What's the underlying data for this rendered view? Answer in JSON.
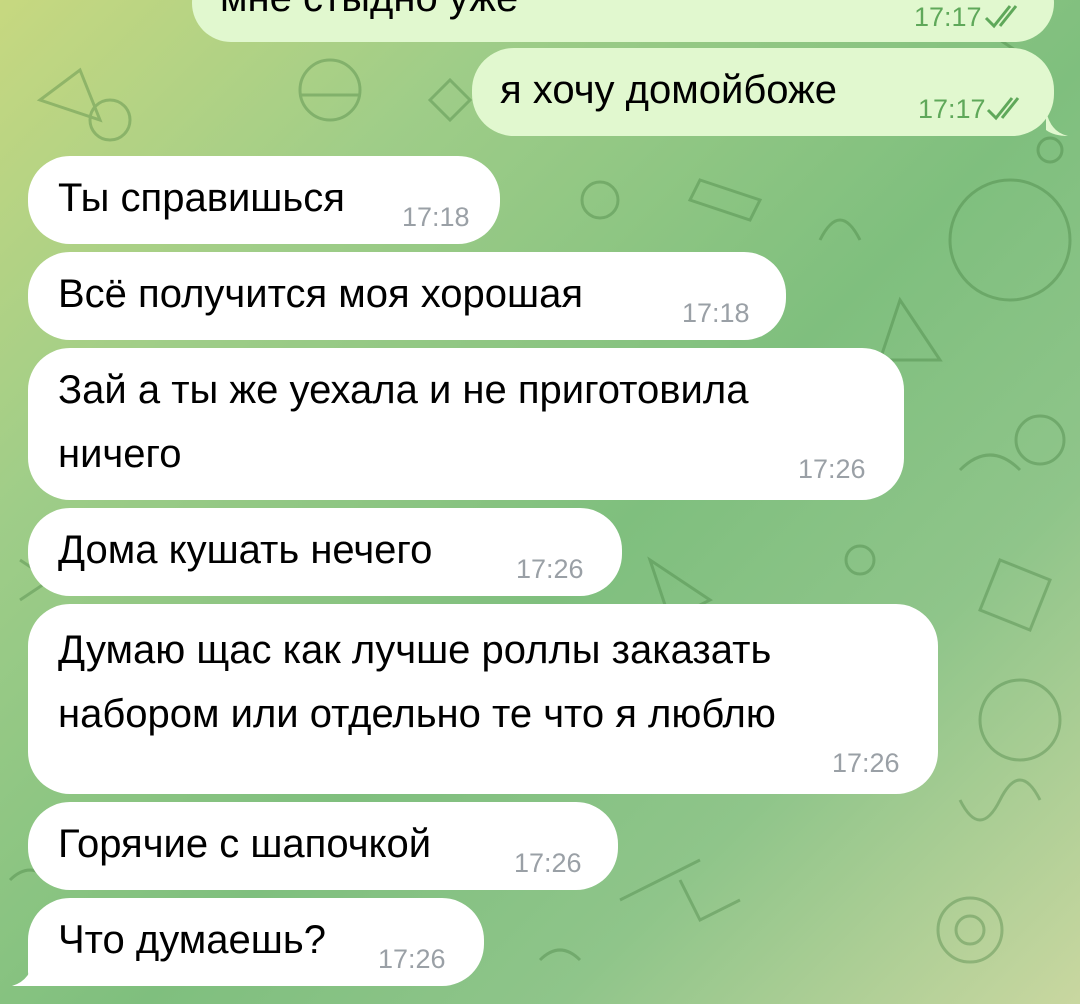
{
  "chat": {
    "messages": [
      {
        "direction": "out",
        "text": "мне стыдно уже",
        "time": "17:17",
        "status_icon": "double-check-icon"
      },
      {
        "direction": "out",
        "text": "я хочу домойбоже",
        "time": "17:17",
        "status_icon": "double-check-icon"
      },
      {
        "direction": "in",
        "text": "Ты справишься",
        "time": "17:18"
      },
      {
        "direction": "in",
        "text": "Всё получится моя хорошая",
        "time": "17:18"
      },
      {
        "direction": "in",
        "lines": [
          "Зай а ты же уехала и не приготовила",
          "ничего"
        ],
        "time": "17:26"
      },
      {
        "direction": "in",
        "text": "Дома кушать нечего",
        "time": "17:26"
      },
      {
        "direction": "in",
        "lines": [
          "Думаю щас как лучше роллы заказать",
          "набором или отдельно те что я люблю"
        ],
        "time": "17:26"
      },
      {
        "direction": "in",
        "text": "Горячие с шапочкой",
        "time": "17:26"
      },
      {
        "direction": "in",
        "text": "Что думаешь?",
        "time": "17:26"
      }
    ]
  },
  "colors": {
    "incoming_bubble": "#ffffff",
    "outgoing_bubble": "#e1f8cf",
    "outgoing_meta": "#5fa85a",
    "incoming_meta": "#9aa0a6"
  }
}
